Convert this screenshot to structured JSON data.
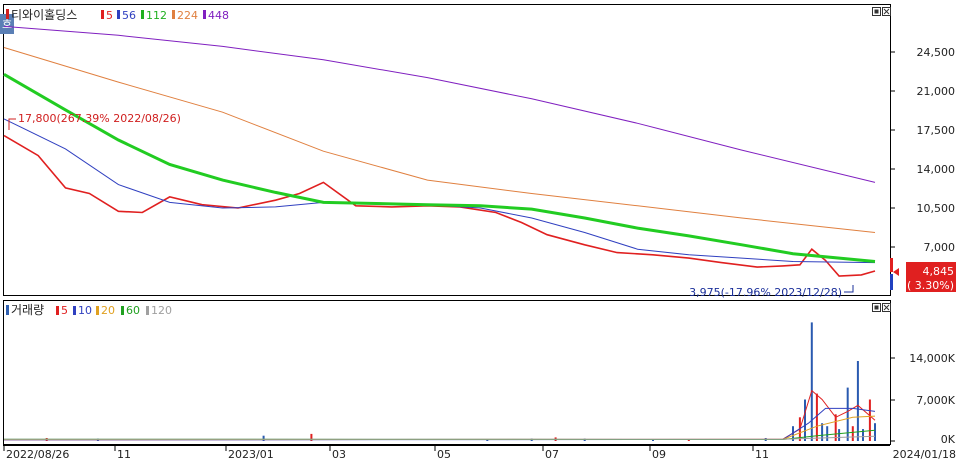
{
  "price_panel": {
    "legend": [
      {
        "text": "티와이홀딩스",
        "color": "#222222"
      },
      {
        "text": "5",
        "color": "#e02020"
      },
      {
        "text": "56",
        "color": "#3040c0"
      },
      {
        "text": "112",
        "color": "#20b020"
      },
      {
        "text": "224",
        "color": "#e08040"
      },
      {
        "text": "448",
        "color": "#8020c0"
      }
    ],
    "badge": "호",
    "high_annotation": "17,800(267.39% 2022/08/26)",
    "low_annotation": "3,975(-17.96% 2023/12/28)",
    "current_price": "4,845",
    "current_change": "( 3.30%)",
    "y_ticks": [
      "24,500",
      "21,000",
      "17,500",
      "14,000",
      "10,500",
      "7,000"
    ]
  },
  "volume_panel": {
    "legend": [
      {
        "text": "거래량",
        "color": "#222222"
      },
      {
        "text": "5",
        "color": "#e02020"
      },
      {
        "text": "10",
        "color": "#3040c0"
      },
      {
        "text": "20",
        "color": "#e0a020"
      },
      {
        "text": "60",
        "color": "#20a020"
      },
      {
        "text": "120",
        "color": "#a0a0a0"
      }
    ],
    "y_ticks": [
      "14,000K",
      "7,000K",
      "0K"
    ]
  },
  "x_axis": {
    "labels": [
      "2022/08/26",
      "11",
      "2023/01",
      "03",
      "05",
      "07",
      "09",
      "11",
      "2024/01/18"
    ]
  },
  "chart_data": {
    "type": "line",
    "x_range": [
      "2022/08/26",
      "2024/01/18"
    ],
    "price": {
      "ylim": [
        3500,
        27500
      ],
      "series": [
        {
          "name": "5",
          "color": "#e02020",
          "x": [
            "2022/08/26",
            "2022/09/15",
            "2022/10/01",
            "2022/10/15",
            "2022/11/01",
            "2022/11/15",
            "2022/12/01",
            "2022/12/20",
            "2023/01/10",
            "2023/02/01",
            "2023/02/15",
            "2023/03/01",
            "2023/03/20",
            "2023/04/10",
            "2023/05/01",
            "2023/05/20",
            "2023/06/10",
            "2023/06/25",
            "2023/07/10",
            "2023/08/01",
            "2023/08/20",
            "2023/09/10",
            "2023/10/01",
            "2023/10/20",
            "2023/11/10",
            "2023/11/25",
            "2023/12/05",
            "2023/12/12",
            "2023/12/20",
            "2023/12/28",
            "2024/01/10",
            "2024/01/18"
          ],
          "values": [
            17000,
            15200,
            12300,
            11800,
            10200,
            10100,
            11500,
            10800,
            10500,
            11200,
            11800,
            12800,
            10700,
            10600,
            10700,
            10600,
            10100,
            9200,
            8100,
            7200,
            6500,
            6300,
            6000,
            5600,
            5200,
            5300,
            5400,
            6800,
            5800,
            4400,
            4500,
            4845
          ]
        },
        {
          "name": "56",
          "color": "#3040c0",
          "x": [
            "2022/08/26",
            "2022/10/01",
            "2022/11/01",
            "2022/12/01",
            "2023/01/01",
            "2023/02/01",
            "2023/03/01",
            "2023/04/01",
            "2023/05/01",
            "2023/06/01",
            "2023/07/01",
            "2023/08/01",
            "2023/09/01",
            "2023/10/01",
            "2023/11/01",
            "2023/12/01",
            "2024/01/18"
          ],
          "values": [
            18500,
            15800,
            12600,
            11000,
            10500,
            10600,
            11000,
            10900,
            10800,
            10500,
            9600,
            8300,
            6800,
            6300,
            6000,
            5700,
            5600
          ]
        },
        {
          "name": "112",
          "color": "#22cc22",
          "x": [
            "2022/08/26",
            "2022/10/01",
            "2022/11/01",
            "2022/12/01",
            "2023/01/01",
            "2023/02/01",
            "2023/03/01",
            "2023/04/01",
            "2023/05/01",
            "2023/06/01",
            "2023/07/01",
            "2023/08/01",
            "2023/09/01",
            "2023/10/01",
            "2023/11/01",
            "2023/12/01",
            "2024/01/18"
          ],
          "values": [
            22500,
            19300,
            16600,
            14400,
            13000,
            11900,
            11000,
            10900,
            10800,
            10700,
            10400,
            9600,
            8700,
            8000,
            7200,
            6400,
            5700
          ]
        },
        {
          "name": "224",
          "color": "#e08040",
          "x": [
            "2022/08/26",
            "2022/11/01",
            "2023/01/01",
            "2023/03/01",
            "2023/05/01",
            "2023/07/01",
            "2023/09/01",
            "2023/11/01",
            "2024/01/18"
          ],
          "values": [
            24900,
            21800,
            19100,
            15600,
            13000,
            11800,
            10700,
            9600,
            8300
          ]
        },
        {
          "name": "448",
          "color": "#8020c0",
          "x": [
            "2022/08/26",
            "2022/11/01",
            "2023/01/01",
            "2023/03/01",
            "2023/05/01",
            "2023/07/01",
            "2023/09/01",
            "2023/11/01",
            "2024/01/18"
          ],
          "values": [
            26800,
            26000,
            25000,
            23800,
            22200,
            20300,
            18100,
            15700,
            12800
          ]
        }
      ]
    },
    "volume": {
      "ylim": [
        0,
        22000
      ],
      "unit": "K",
      "bars": {
        "x": [
          "2022/09/20",
          "2022/10/20",
          "2023/01/25",
          "2023/02/22",
          "2023/06/05",
          "2023/07/01",
          "2023/07/15",
          "2023/08/01",
          "2023/09/10",
          "2023/10/01",
          "2023/11/15",
          "2023/12/01",
          "2023/12/05",
          "2023/12/08",
          "2023/12/12",
          "2023/12/15",
          "2023/12/18",
          "2023/12/21",
          "2023/12/26",
          "2023/12/28",
          "2024/01/02",
          "2024/01/05",
          "2024/01/08",
          "2024/01/11",
          "2024/01/15",
          "2024/01/18"
        ],
        "values": [
          500,
          400,
          900,
          1200,
          300,
          400,
          600,
          400,
          300,
          300,
          500,
          2500,
          4000,
          7000,
          20000,
          8000,
          3000,
          2500,
          4500,
          2000,
          9000,
          2500,
          13500,
          2000,
          7000,
          3000
        ]
      },
      "series": [
        {
          "name": "5",
          "color": "#e02020",
          "x": [
            "2022/08/26",
            "2023/11/25",
            "2023/12/05",
            "2023/12/12",
            "2023/12/18",
            "2023/12/26",
            "2024/01/02",
            "2024/01/08",
            "2024/01/18"
          ],
          "values": [
            200,
            300,
            2000,
            8500,
            7000,
            4000,
            5000,
            6000,
            3500
          ]
        },
        {
          "name": "10",
          "color": "#3040c0",
          "x": [
            "2022/08/26",
            "2023/11/25",
            "2023/12/10",
            "2023/12/20",
            "2024/01/05",
            "2024/01/18"
          ],
          "values": [
            200,
            250,
            3000,
            5500,
            5500,
            5000
          ]
        },
        {
          "name": "20",
          "color": "#e0a020",
          "x": [
            "2022/08/26",
            "2023/11/25",
            "2023/12/15",
            "2024/01/05",
            "2024/01/18"
          ],
          "values": [
            250,
            250,
            2500,
            4000,
            4200
          ]
        },
        {
          "name": "60",
          "color": "#20a020",
          "x": [
            "2022/08/26",
            "2023/11/25",
            "2023/12/15",
            "2024/01/18"
          ],
          "values": [
            300,
            250,
            900,
            1800
          ]
        },
        {
          "name": "120",
          "color": "#a0a0a0",
          "x": [
            "2022/08/26",
            "2023/11/25",
            "2024/01/18"
          ],
          "values": [
            300,
            300,
            800
          ]
        }
      ]
    }
  }
}
